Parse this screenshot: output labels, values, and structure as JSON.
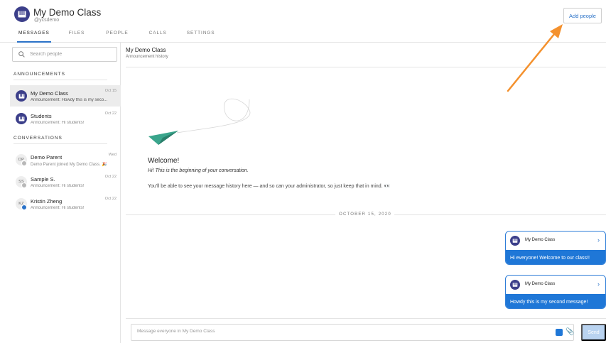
{
  "header": {
    "class_title": "My Demo Class",
    "class_handle": "@ycsdemo",
    "add_people_label": "Add people",
    "tabs": [
      {
        "label": "MESSAGES",
        "active": true
      },
      {
        "label": "FILES",
        "active": false
      },
      {
        "label": "PEOPLE",
        "active": false
      },
      {
        "label": "CALLS",
        "active": false
      },
      {
        "label": "SETTINGS",
        "active": false
      }
    ]
  },
  "sidebar": {
    "search_placeholder": "Search people",
    "announcements_label": "ANNOUNCEMENTS",
    "announcements": [
      {
        "name": "My Demo Class",
        "preview": "Announcement: Howdy this is my seco...",
        "date": "Oct 15",
        "selected": true
      },
      {
        "name": "Students",
        "preview": "Announcement: Hi students!",
        "date": "Oct 22",
        "selected": false
      }
    ],
    "conversations_label": "CONVERSATIONS",
    "conversations": [
      {
        "initials": "DP",
        "name": "Demo Parent",
        "preview": "Demo Parent joined My Demo Class. 🎉",
        "date": "Wed",
        "badge": "grey"
      },
      {
        "initials": "SS",
        "name": "Sample S.",
        "preview": "Announcement: Hi students!",
        "date": "Oct 22",
        "badge": "grey"
      },
      {
        "initials": "KZ",
        "name": "Kristin Zheng",
        "preview": "Announcement: Hi students!",
        "date": "Oct 22",
        "badge": "blue"
      }
    ]
  },
  "conversation": {
    "title": "My Demo Class",
    "subtitle": "Announcement history",
    "welcome_title": "Welcome!",
    "welcome_subtitle": "Hi! This is the beginning of your conversation.",
    "welcome_body": "You'll be able to see your message history here — and so can your administrator, so just keep that in mind. 👀",
    "date_divider": "OCTOBER 15, 2020",
    "messages": [
      {
        "sender": "My Demo Class",
        "text": "Hi everyone! Welcome to our class!!"
      },
      {
        "sender": "My Demo Class",
        "text": "Howdy this is my second message!"
      }
    ],
    "composer_placeholder": "Message everyone in My Demo Class",
    "send_label": "Send"
  },
  "colors": {
    "accent": "#1f77d7",
    "avatar": "#3c3f8a",
    "annotation_arrow": "#f4912e",
    "plane": "#3aa58c"
  }
}
